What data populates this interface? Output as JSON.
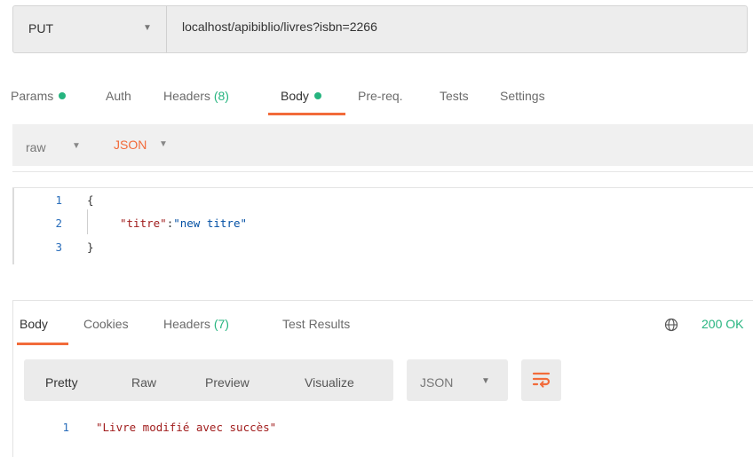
{
  "request": {
    "method": "PUT",
    "url": "localhost/apibiblio/livres?isbn=2266",
    "tabs": {
      "params": "Params",
      "auth": "Auth",
      "headers": "Headers",
      "headers_count": "(8)",
      "body": "Body",
      "prereq": "Pre-req.",
      "tests": "Tests",
      "settings": "Settings"
    },
    "body_mode": "raw",
    "body_format": "JSON",
    "editor_lines": [
      {
        "num": "1",
        "text": "{"
      },
      {
        "num": "2",
        "key": "\"titre\"",
        "colon": ":",
        "value": "\"new titre\""
      },
      {
        "num": "3",
        "text": "}"
      }
    ]
  },
  "response": {
    "tabs": {
      "body": "Body",
      "cookies": "Cookies",
      "headers": "Headers",
      "headers_count": "(7)",
      "test_results": "Test Results"
    },
    "status": "200 OK",
    "status_color": "#26b47f",
    "view_modes": [
      "Pretty",
      "Raw",
      "Preview",
      "Visualize"
    ],
    "format": "JSON",
    "lines": [
      {
        "num": "1",
        "text": "\"Livre modifié avec succès\""
      }
    ]
  },
  "colors": {
    "accent": "#f26b3a",
    "success": "#26b47f"
  },
  "icons": {
    "method_dropdown": "chevron-down-icon",
    "globe": "globe-icon",
    "wrap": "wrap-lines-icon"
  }
}
